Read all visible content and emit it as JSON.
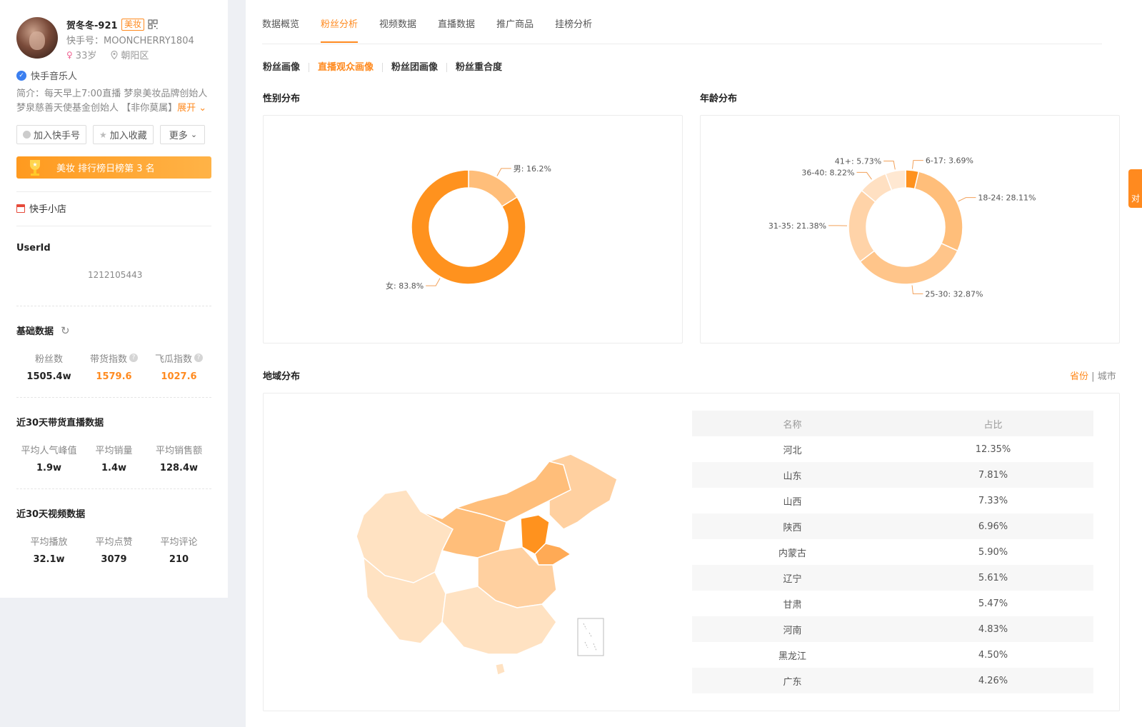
{
  "profile": {
    "name": "贺冬冬-921",
    "tag": "美妆",
    "account_id": "快手号：MOONCHERRY1804",
    "age": "33岁",
    "location": "朝阳区",
    "verify": "快手音乐人",
    "intro_line1": "简介：每天早上7:00直播 梦泉美妆品牌创始人",
    "intro_line2": "梦泉慈善天使基金创始人 【非你莫属】",
    "expand": "展开"
  },
  "buttons": {
    "add_account": "加入快手号",
    "add_fav": "加入收藏",
    "more": "更多"
  },
  "rank_banner": "美妆 排行榜日榜第 3 名",
  "shop": "快手小店",
  "userid": {
    "label": "UserId",
    "value": "1212105443"
  },
  "basic": {
    "title": "基础数据",
    "items": [
      {
        "label": "粉丝数",
        "value": "1505.4w"
      },
      {
        "label": "带货指数",
        "value": "1579.6"
      },
      {
        "label": "飞瓜指数",
        "value": "1027.6"
      }
    ]
  },
  "live30": {
    "title": "近30天带货直播数据",
    "items": [
      {
        "label": "平均人气峰值",
        "value": "1.9w"
      },
      {
        "label": "平均销量",
        "value": "1.4w"
      },
      {
        "label": "平均销售额",
        "value": "128.4w"
      }
    ]
  },
  "video30": {
    "title": "近30天视频数据",
    "items": [
      {
        "label": "平均播放",
        "value": "32.1w"
      },
      {
        "label": "平均点赞",
        "value": "3079"
      },
      {
        "label": "平均评论",
        "value": "210"
      }
    ]
  },
  "tabs": [
    "数据概览",
    "粉丝分析",
    "视频数据",
    "直播数据",
    "推广商品",
    "挂榜分析"
  ],
  "subtabs": [
    "粉丝画像",
    "直播观众画像",
    "粉丝团画像",
    "粉丝重合度"
  ],
  "sections": {
    "gender": "性别分布",
    "age": "年龄分布",
    "region": "地域分布"
  },
  "region_switch": {
    "province": "省份",
    "sep": "|",
    "city": "城市"
  },
  "float_tab": "对",
  "colors": {
    "accent": "#ff8a1f",
    "light": "#ffbe7a",
    "pale": "#ffe2c2"
  },
  "chart_data": [
    {
      "type": "pie",
      "title": "性别分布",
      "slices": [
        {
          "label": "男",
          "value": 16.2,
          "text": "男: 16.2%",
          "color": "#ffbe7a"
        },
        {
          "label": "女",
          "value": 83.8,
          "text": "女: 83.8%",
          "color": "#ff921e"
        }
      ]
    },
    {
      "type": "pie",
      "title": "年龄分布",
      "slices": [
        {
          "label": "6-17",
          "value": 3.69,
          "text": "6-17: 3.69%",
          "color": "#ff921e"
        },
        {
          "label": "18-24",
          "value": 28.11,
          "text": "18-24: 28.11%",
          "color": "#ffbe7a"
        },
        {
          "label": "25-30",
          "value": 32.87,
          "text": "25-30: 32.87%",
          "color": "#ffc58a"
        },
        {
          "label": "31-35",
          "value": 21.38,
          "text": "31-35: 21.38%",
          "color": "#ffd3a8"
        },
        {
          "label": "36-40",
          "value": 8.22,
          "text": "36-40: 8.22%",
          "color": "#ffe0c2"
        },
        {
          "label": "41+",
          "value": 5.73,
          "text": "41+: 5.73%",
          "color": "#ffe8d2"
        }
      ]
    },
    {
      "type": "table",
      "title": "地域分布",
      "columns": [
        "名称",
        "占比"
      ],
      "rows": [
        [
          "河北",
          "12.35%"
        ],
        [
          "山东",
          "7.81%"
        ],
        [
          "山西",
          "7.33%"
        ],
        [
          "陕西",
          "6.96%"
        ],
        [
          "内蒙古",
          "5.90%"
        ],
        [
          "辽宁",
          "5.61%"
        ],
        [
          "甘肃",
          "5.47%"
        ],
        [
          "河南",
          "4.83%"
        ],
        [
          "黑龙江",
          "4.50%"
        ],
        [
          "广东",
          "4.26%"
        ]
      ]
    }
  ]
}
